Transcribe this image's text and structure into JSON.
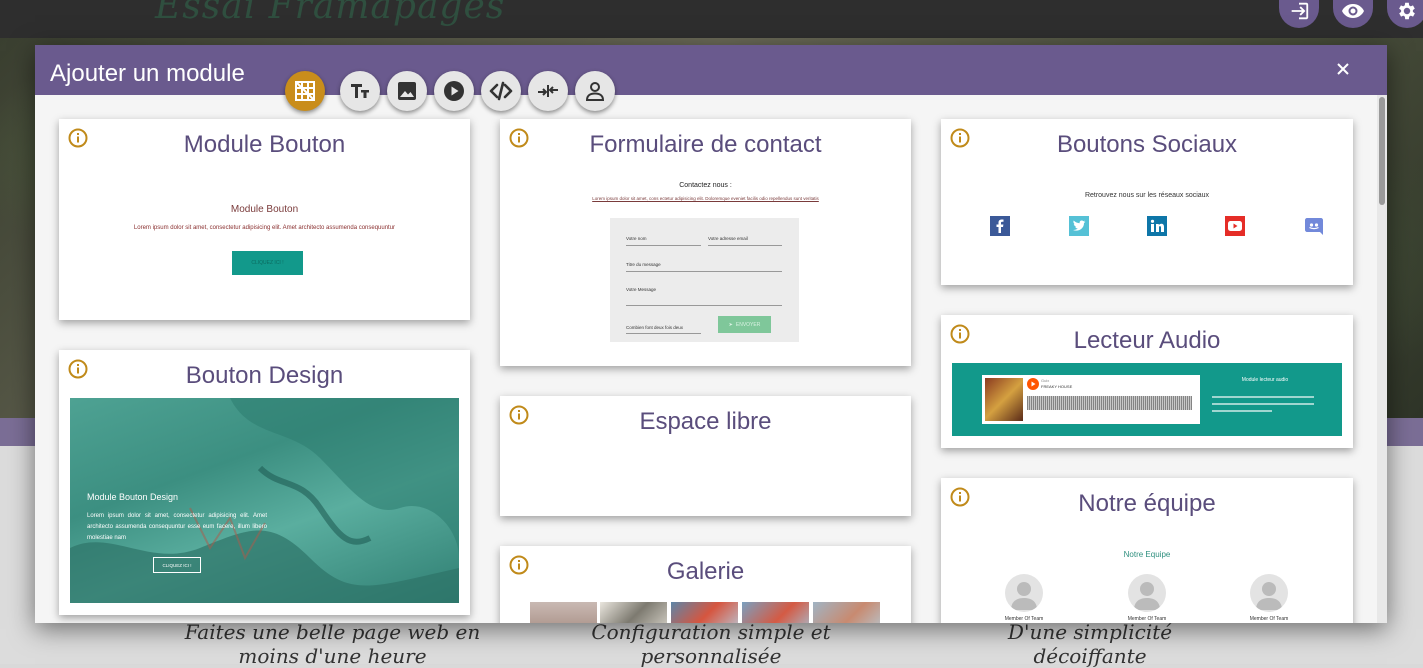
{
  "background": {
    "site_title": "Essai Framapages",
    "features": [
      "Faites une belle page web en moins d'une heure",
      "Configuration simple et personnalisée",
      "D'une simplicité décoiffante"
    ]
  },
  "topbar": {
    "buttons": [
      "sign-in-icon",
      "eye-icon",
      "gear-icon"
    ]
  },
  "modal": {
    "title": "Ajouter un module",
    "close_label": "×",
    "toolbar": [
      "grid-icon",
      "text-icon",
      "image-icon",
      "play-icon",
      "code-icon",
      "merge-icon",
      "person-icon"
    ]
  },
  "cards": {
    "module_bouton": {
      "title": "Module Bouton",
      "preview_heading": "Module Bouton",
      "preview_text": "Lorem ipsum dolor sit amet, consectetur adipisicing elit. Amet architecto assumenda consequuntur",
      "preview_button": "CLIQUEZ ICI !"
    },
    "bouton_design": {
      "title": "Bouton Design",
      "preview_heading": "Module Bouton Design",
      "preview_text": "Lorem ipsum dolor sit amet, consectetur adipisicing elit. Amet architecto assumenda consequuntur esse eum facere, illum libero molestiae nam",
      "preview_button": "CLIQUEZ ICI !"
    },
    "formulaire": {
      "title": "Formulaire de contact",
      "preview_heading": "Contactez nous :",
      "preview_text": "Lorem ipsum dolor sit amet, cons ectetur adipisicing elit. Doloremque eveniet facilis odio repellendus sunt veritatis",
      "field_name": "Votre nom",
      "field_email": "Votre adresse email",
      "field_subject": "Titre du message",
      "field_message": "Votre Message",
      "field_captcha": "Combien font deux fois deux",
      "send_button": "ENVOYER"
    },
    "espace_libre": {
      "title": "Espace libre"
    },
    "galerie": {
      "title": "Galerie"
    },
    "boutons_sociaux": {
      "title": "Boutons Sociaux",
      "preview_text": "Retrouvez nous sur les réseaux sociaux"
    },
    "lecteur_audio": {
      "title": "Lecteur Audio",
      "preview_heading": "Module lecteur audio",
      "track_user": "Guix",
      "track_name": "FREAKY HOUSE"
    },
    "notre_equipe": {
      "title": "Notre équipe",
      "preview_heading": "Notre Equipe",
      "members": [
        "Member Of Team",
        "Member Of Team",
        "Member Of Team"
      ]
    }
  },
  "colors": {
    "header": "#6a5a8e",
    "active_tool": "#c98d1b",
    "teal": "#12998b",
    "title_text": "#5a4d7c"
  }
}
